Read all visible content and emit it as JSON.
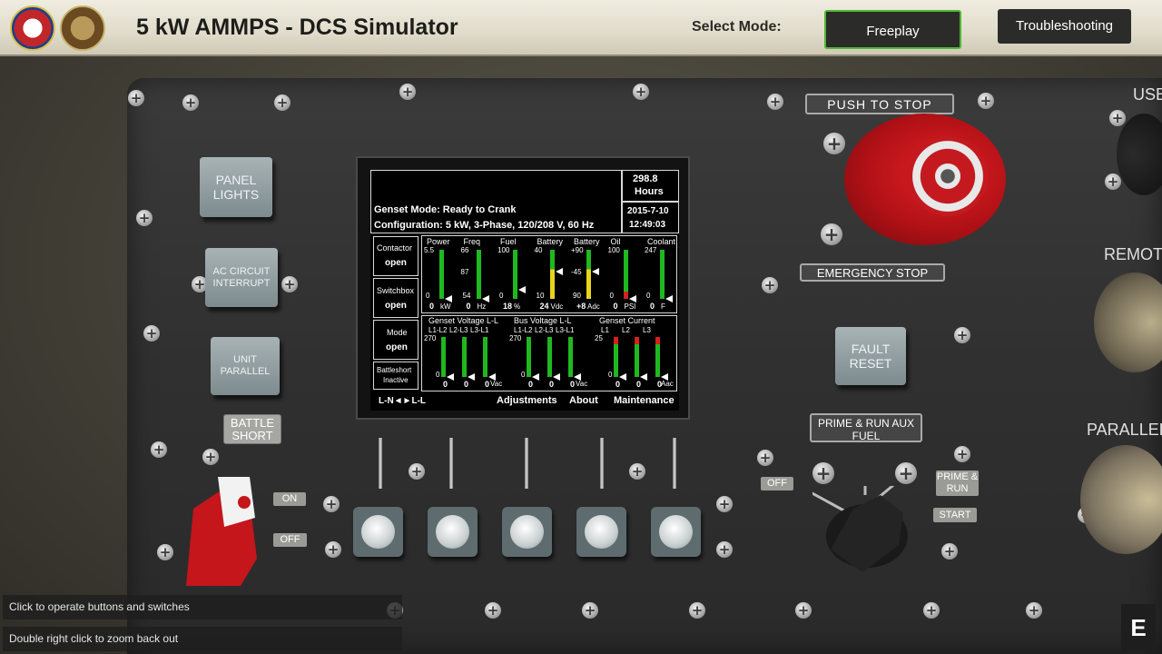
{
  "header": {
    "title": "5 kW AMMPS - DCS Simulator",
    "select_mode_label": "Select Mode:",
    "freeplay_label": "Freeplay",
    "troubleshooting_label": "Troubleshooting"
  },
  "panel": {
    "panel_lights": "PANEL LIGHTS",
    "ac_circuit_interrupt": "AC CIRCUIT INTERRUPT",
    "unit_parallel": "UNIT PARALLEL",
    "battle_short": "BATTLE SHORT",
    "switch_on": "ON",
    "switch_off": "OFF",
    "push_to_stop": "PUSH TO STOP",
    "emergency_stop": "EMERGENCY STOP",
    "fault_reset": "FAULT RESET",
    "prime_run_aux_fuel": "PRIME & RUN AUX FUEL",
    "selector_off": "OFF",
    "selector_prime_run": "PRIME & RUN",
    "selector_start": "START",
    "side_use": "USE",
    "side_remote": "REMOT",
    "side_parallel": "PARALLEL"
  },
  "display": {
    "hours_value": "298.8",
    "hours_label": "Hours",
    "date": "2015-7-10",
    "time": "12:49:03",
    "genset_mode": "Genset Mode: Ready to Crank",
    "configuration": "Configuration:  5 kW, 3-Phase, 120/208 V, 60 Hz",
    "contactor_label": "Contactor",
    "contactor_value": "open",
    "switchbox_label": "Switchbox",
    "switchbox_value": "open",
    "mode_label": "Mode",
    "mode_value": "open",
    "battleshort_label": "Battleshort",
    "battleshort_value": "Inactive",
    "gauges": [
      {
        "title": "Power",
        "top": "5.5",
        "mid": "",
        "bottom": "0",
        "value": "0",
        "unit": "kW",
        "level": 0
      },
      {
        "title": "Freq",
        "top": "66",
        "mid": "87",
        "bottom": "54",
        "value": "0",
        "unit": "Hz",
        "level": 0
      },
      {
        "title": "Fuel",
        "top": "100",
        "mid": "",
        "bottom": "0",
        "value": "18",
        "unit": "%",
        "level": 0.18
      },
      {
        "title": "Battery",
        "top": "40",
        "mid": "",
        "bottom": "10",
        "value": "24",
        "unit": "Vdc",
        "level": 0.55
      },
      {
        "title": "Battery",
        "top": "+90",
        "mid": "-45",
        "bottom": "90",
        "value": "+8",
        "unit": "Adc",
        "level": 0.55
      },
      {
        "title": "Oil",
        "top": "100",
        "mid": "",
        "bottom": "0",
        "value": "0",
        "unit": "PSI",
        "level": 0
      },
      {
        "title": "Coolant",
        "top": "247",
        "mid": "",
        "bottom": "0",
        "value": "0",
        "unit": "F",
        "level": 0
      }
    ],
    "genset_voltage_title": "Genset Voltage L-L",
    "genset_voltage_cols": [
      "L1-L2",
      "L2-L3",
      "L3-L1"
    ],
    "genset_voltage_top": "270",
    "genset_voltage_values": [
      "0",
      "0",
      "0"
    ],
    "genset_voltage_unit": "Vac",
    "bus_voltage_title": "Bus Voltage L-L",
    "bus_voltage_cols": [
      "L1-L2",
      "L2-L3",
      "L3-L1"
    ],
    "bus_voltage_top": "270",
    "bus_voltage_values": [
      "0",
      "0",
      "0"
    ],
    "bus_voltage_unit": "Vac",
    "genset_current_title": "Genset Current",
    "genset_current_cols": [
      "L1",
      "L2",
      "L3"
    ],
    "genset_current_top": "25",
    "genset_current_values": [
      "0",
      "0",
      "0"
    ],
    "genset_current_unit": "Aac",
    "zero": "0",
    "menu_ln_ll": "L-N◄►L-L",
    "menu_adjustments": "Adjustments",
    "menu_about": "About",
    "menu_maintenance": "Maintenance"
  },
  "hints": {
    "hint1": "Click to operate buttons and switches",
    "hint2": "Double right click to zoom back out"
  },
  "e_label": "E",
  "colors": {
    "bar_green": "#1fb81f",
    "bar_yellow": "#e8d41a",
    "bar_red": "#d62020",
    "freeplay_border": "#4fb832"
  }
}
